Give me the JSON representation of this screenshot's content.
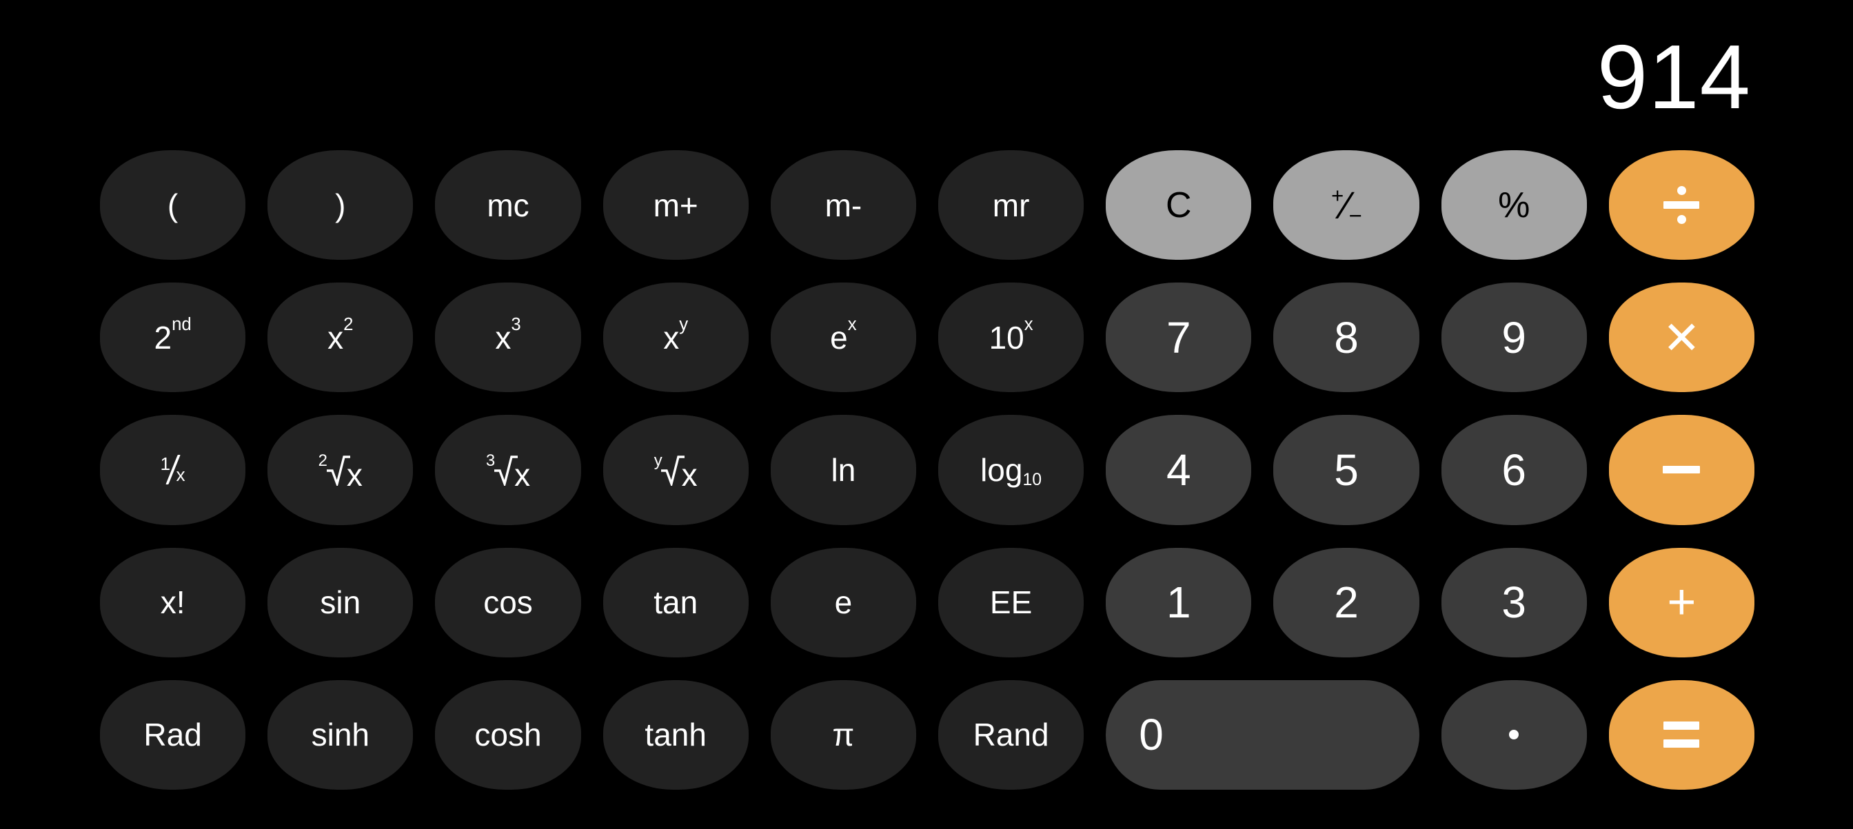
{
  "app": {
    "name": "Calculator",
    "mode": "scientific"
  },
  "display": {
    "value": "914"
  },
  "colors": {
    "background": "#000000",
    "function_key": "#222222",
    "number_key": "#3b3b3b",
    "top_key": "#a5a5a5",
    "operator_key": "#eda64a",
    "text_light": "#ffffff",
    "text_dark": "#000000"
  },
  "keypad": {
    "rows": [
      {
        "keys": [
          {
            "label": "(",
            "name": "open-paren",
            "type": "fn"
          },
          {
            "label": ")",
            "name": "close-paren",
            "type": "fn"
          },
          {
            "label": "mc",
            "name": "memory-clear",
            "type": "fn"
          },
          {
            "label": "m+",
            "name": "memory-add",
            "type": "fn"
          },
          {
            "label": "m-",
            "name": "memory-subtract",
            "type": "fn"
          },
          {
            "label": "mr",
            "name": "memory-recall",
            "type": "fn"
          },
          {
            "label": "C",
            "name": "clear",
            "type": "top"
          },
          {
            "label": "+/-",
            "name": "sign-toggle",
            "type": "top"
          },
          {
            "label": "%",
            "name": "percent",
            "type": "top"
          },
          {
            "label": "÷",
            "name": "divide",
            "type": "op"
          }
        ]
      },
      {
        "keys": [
          {
            "label": "2nd",
            "name": "second-function",
            "type": "fn"
          },
          {
            "label": "x²",
            "name": "square",
            "type": "fn"
          },
          {
            "label": "x³",
            "name": "cube",
            "type": "fn"
          },
          {
            "label": "xʸ",
            "name": "power-xy",
            "type": "fn"
          },
          {
            "label": "eˣ",
            "name": "exp-e",
            "type": "fn"
          },
          {
            "label": "10ˣ",
            "name": "exp-ten",
            "type": "fn"
          },
          {
            "label": "7",
            "name": "digit-7",
            "type": "num"
          },
          {
            "label": "8",
            "name": "digit-8",
            "type": "num"
          },
          {
            "label": "9",
            "name": "digit-9",
            "type": "num"
          },
          {
            "label": "×",
            "name": "multiply",
            "type": "op"
          }
        ]
      },
      {
        "keys": [
          {
            "label": "1/x",
            "name": "reciprocal",
            "type": "fn"
          },
          {
            "label": "²√x",
            "name": "square-root",
            "type": "fn"
          },
          {
            "label": "³√x",
            "name": "cube-root",
            "type": "fn"
          },
          {
            "label": "ʸ√x",
            "name": "nth-root",
            "type": "fn"
          },
          {
            "label": "ln",
            "name": "natural-log",
            "type": "fn"
          },
          {
            "label": "log₁₀",
            "name": "log-base-ten",
            "type": "fn"
          },
          {
            "label": "4",
            "name": "digit-4",
            "type": "num"
          },
          {
            "label": "5",
            "name": "digit-5",
            "type": "num"
          },
          {
            "label": "6",
            "name": "digit-6",
            "type": "num"
          },
          {
            "label": "−",
            "name": "subtract",
            "type": "op"
          }
        ]
      },
      {
        "keys": [
          {
            "label": "x!",
            "name": "factorial",
            "type": "fn"
          },
          {
            "label": "sin",
            "name": "sine",
            "type": "fn"
          },
          {
            "label": "cos",
            "name": "cosine",
            "type": "fn"
          },
          {
            "label": "tan",
            "name": "tangent",
            "type": "fn"
          },
          {
            "label": "e",
            "name": "euler-e",
            "type": "fn"
          },
          {
            "label": "EE",
            "name": "exponent-ee",
            "type": "fn"
          },
          {
            "label": "1",
            "name": "digit-1",
            "type": "num"
          },
          {
            "label": "2",
            "name": "digit-2",
            "type": "num"
          },
          {
            "label": "3",
            "name": "digit-3",
            "type": "num"
          },
          {
            "label": "+",
            "name": "add",
            "type": "op"
          }
        ]
      },
      {
        "keys": [
          {
            "label": "Rad",
            "name": "radian-mode",
            "type": "fn"
          },
          {
            "label": "sinh",
            "name": "hyperbolic-sine",
            "type": "fn"
          },
          {
            "label": "cosh",
            "name": "hyperbolic-cosine",
            "type": "fn"
          },
          {
            "label": "tanh",
            "name": "hyperbolic-tangent",
            "type": "fn"
          },
          {
            "label": "π",
            "name": "pi",
            "type": "fn"
          },
          {
            "label": "Rand",
            "name": "random",
            "type": "fn"
          },
          {
            "label": "0",
            "name": "digit-0",
            "type": "num",
            "wide": true
          },
          {
            "label": ".",
            "name": "decimal-point",
            "type": "num"
          },
          {
            "label": "=",
            "name": "equals",
            "type": "op"
          }
        ]
      }
    ]
  }
}
